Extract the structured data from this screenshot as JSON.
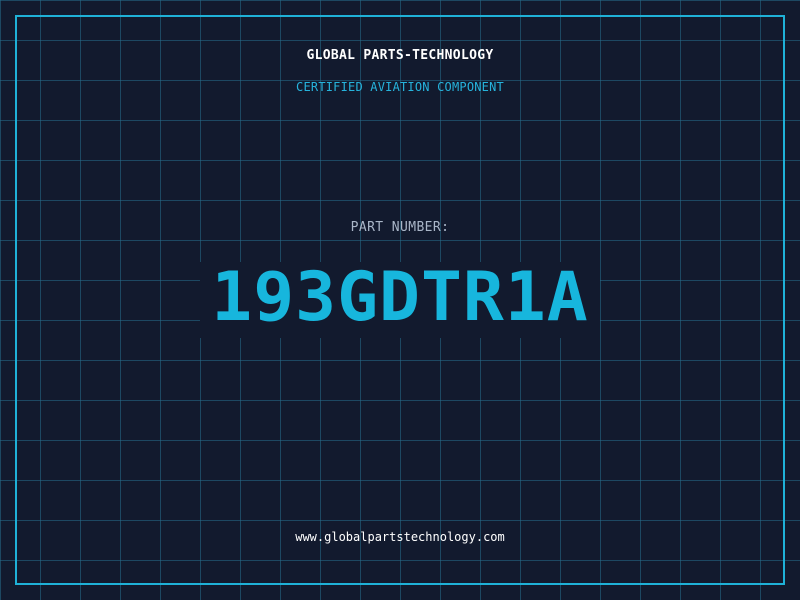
{
  "brand": {
    "title": "GLOBAL PARTS-TECHNOLOGY",
    "subtitle": "CERTIFIED AVIATION COMPONENT"
  },
  "part": {
    "label": "PART NUMBER:",
    "number": "193GDTR1A"
  },
  "footer": {
    "website": "www.globalpartstechnology.com"
  },
  "colors": {
    "background": "#121a2e",
    "grid": "#266e8c",
    "frame": "#1fb1d8",
    "accent": "#17b6dd",
    "title": "#ffffff",
    "label": "#aab6c8"
  }
}
